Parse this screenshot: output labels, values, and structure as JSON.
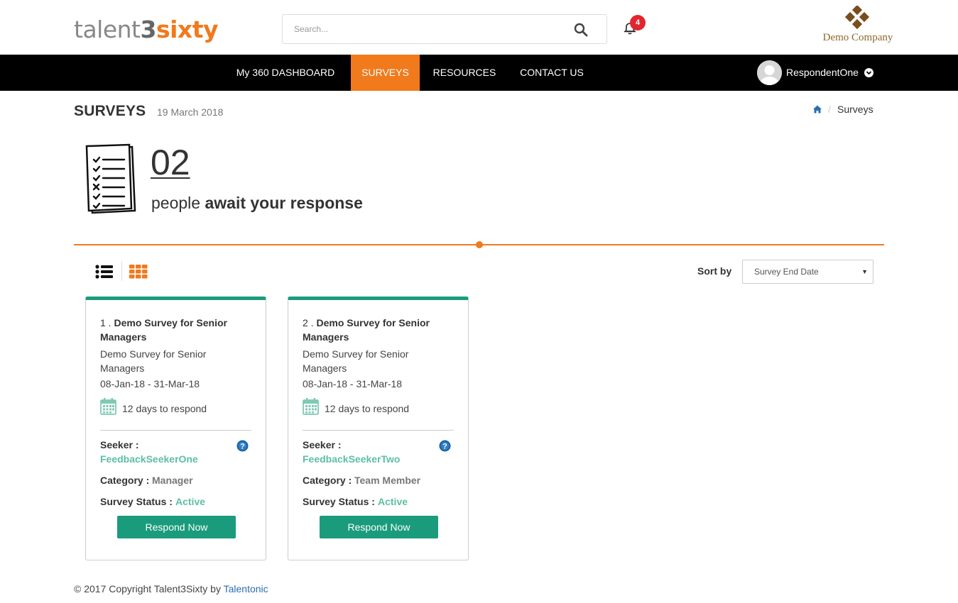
{
  "header": {
    "logo": {
      "part1": "talent",
      "part2": "3",
      "part3": "sixty"
    },
    "search": {
      "placeholder": "Search..."
    },
    "notifications": {
      "count": "4"
    },
    "company": {
      "name": "Demo Company",
      "mark_color": "#7a4d1c"
    }
  },
  "nav": {
    "items": [
      {
        "label": "My 360 DASHBOARD",
        "active": false
      },
      {
        "label": "SURVEYS",
        "active": true
      },
      {
        "label": "RESOURCES",
        "active": false
      },
      {
        "label": "CONTACT US",
        "active": false
      }
    ],
    "user": {
      "name": "RespondentOne"
    }
  },
  "page": {
    "title": "SURVEYS",
    "date": "19 March 2018",
    "breadcrumb": {
      "current": "Surveys",
      "separator": "/"
    }
  },
  "hero": {
    "count": "02",
    "text_prefix": "people ",
    "text_strong": "await your response"
  },
  "toolbar": {
    "sort_label": "Sort by",
    "sort_value": "Survey End Date",
    "active_view": "grid"
  },
  "cards": [
    {
      "number": "1 .",
      "title": "Demo Survey for Senior Managers",
      "subtitle": "Demo Survey for Senior Managers",
      "dates": "08-Jan-18 - 31-Mar-18",
      "days": "12 days to respond",
      "seeker_label": "Seeker :",
      "seeker": "FeedbackSeekerOne",
      "category_label": "Category :",
      "category": "Manager",
      "status_label": "Survey Status :",
      "status": "Active",
      "button": "Respond Now"
    },
    {
      "number": "2 .",
      "title": "Demo Survey for Senior Managers",
      "subtitle": "Demo Survey for Senior Managers",
      "dates": "08-Jan-18 - 31-Mar-18",
      "days": "12 days to respond",
      "seeker_label": "Seeker :",
      "seeker": "FeedbackSeekerTwo",
      "category_label": "Category :",
      "category": "Team Member",
      "status_label": "Survey Status :",
      "status": "Active",
      "button": "Respond Now"
    }
  ],
  "footer": {
    "text": "© 2017 Copyright Talent3Sixty by ",
    "link": "Talentonic"
  },
  "colors": {
    "accent": "#f07a1c",
    "teal": "#1a9b7c",
    "teal_light": "#5cbfa6",
    "badge": "#e3262e"
  }
}
